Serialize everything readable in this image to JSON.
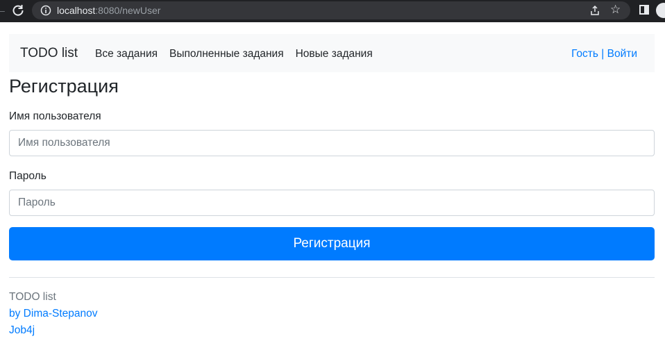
{
  "browser": {
    "url_host": "localhost",
    "url_rest": ":8080/newUser"
  },
  "navbar": {
    "brand": "TODO list",
    "links": [
      "Все задания",
      "Выполненные задания",
      "Новые задания"
    ],
    "user": "Гость",
    "separator": " | ",
    "login": "Войти"
  },
  "form": {
    "title": "Регистрация",
    "username_label": "Имя пользователя",
    "username_placeholder": "Имя пользователя",
    "password_label": "Пароль",
    "password_placeholder": "Пароль",
    "submit_label": "Регистрация"
  },
  "footer": {
    "line1": "TODO list",
    "line2": "by Dima-Stepanov",
    "line3": "Job4j"
  }
}
